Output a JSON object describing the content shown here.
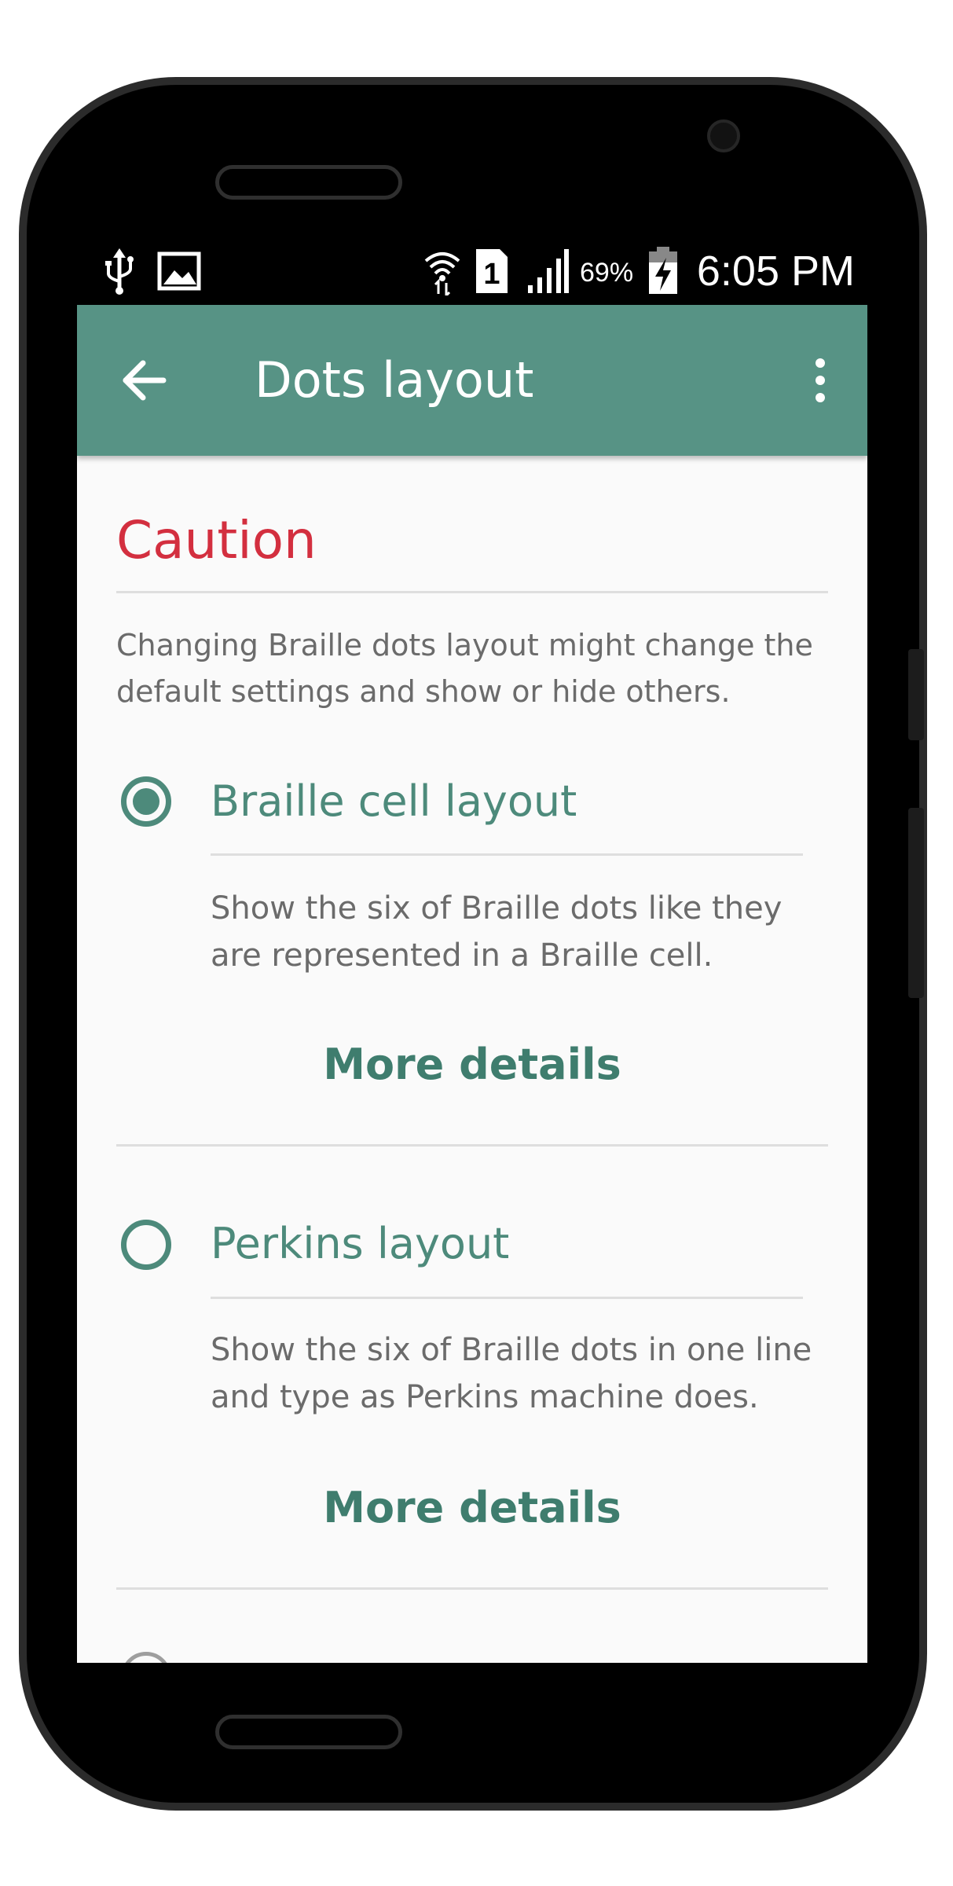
{
  "status_bar": {
    "time": "6:05 PM",
    "battery_percent": "69%",
    "sim_slot": "1",
    "icons": [
      "usb-icon",
      "image-icon",
      "wifi-icon",
      "sim-icon",
      "signal-icon",
      "battery-charging-icon"
    ]
  },
  "toolbar": {
    "title": "Dots layout",
    "back_icon": "arrow-back-icon",
    "menu_icon": "more-vert-icon",
    "color": "#579385"
  },
  "caution": {
    "title": "Caution",
    "text": "Changing Braille dots layout might change the default settings and show or hide others.",
    "color": "#d32f3f"
  },
  "options": [
    {
      "title": "Braille cell layout",
      "description": "Show the six of Braille dots like they are represented in a Braille cell.",
      "more_label": "More details",
      "selected": true
    },
    {
      "title": "Perkins layout",
      "description": "Show the six of Braille dots in one line and type as Perkins machine does.",
      "more_label": "More details",
      "selected": false
    }
  ],
  "accent_color": "#4d8a7b"
}
